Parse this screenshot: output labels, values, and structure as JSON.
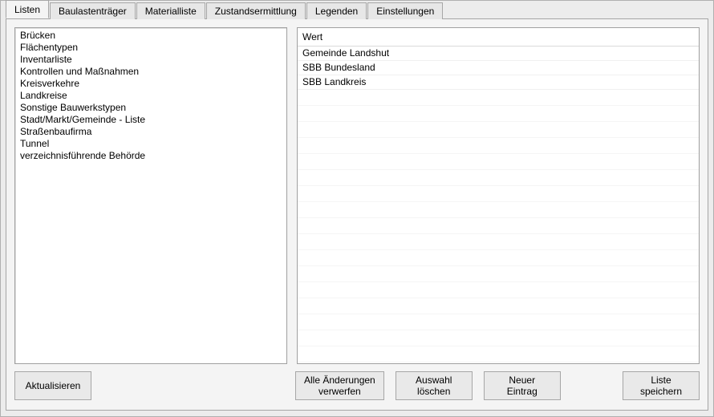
{
  "tabs": [
    {
      "label": "Listen",
      "active": true
    },
    {
      "label": "Baulastenträger"
    },
    {
      "label": "Materialliste"
    },
    {
      "label": "Zustandsermittlung"
    },
    {
      "label": "Legenden"
    },
    {
      "label": "Einstellungen"
    }
  ],
  "leftList": {
    "items": [
      "Brücken",
      "Flächentypen",
      "Inventarliste",
      "Kontrollen und Maßnahmen",
      "Kreisverkehre",
      "Landkreise",
      "Sonstige Bauwerkstypen",
      "Stadt/Markt/Gemeinde - Liste",
      "Straßenbaufirma",
      "Tunnel",
      "verzeichnisführende Behörde"
    ]
  },
  "grid": {
    "header": "Wert",
    "rows": [
      "Gemeinde Landshut",
      "SBB Bundesland",
      "SBB Landkreis"
    ],
    "blankRows": 20
  },
  "buttons": {
    "refresh": "Aktualisieren",
    "discard": "Alle Änderungen\nverwerfen",
    "delete": "Auswahl\nlöschen",
    "new": "Neuer\nEintrag",
    "save": "Liste\nspeichern"
  }
}
